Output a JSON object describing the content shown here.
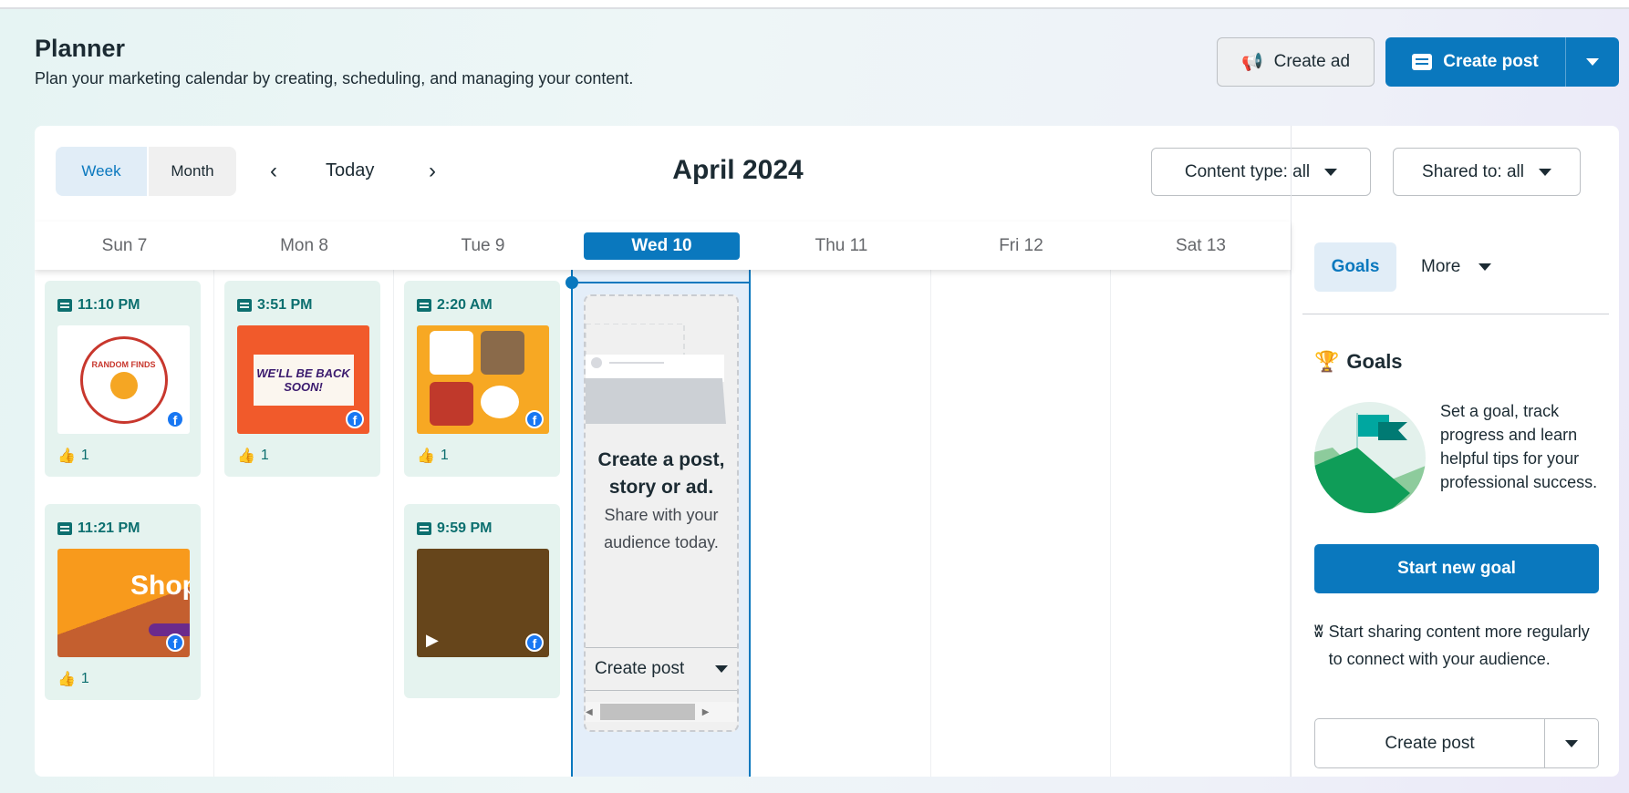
{
  "header": {
    "title": "Planner",
    "subtitle": "Plan your marketing calendar by creating, scheduling, and managing your content.",
    "create_ad_label": "Create ad",
    "create_post_label": "Create post"
  },
  "toolbar": {
    "views": [
      "Week",
      "Month"
    ],
    "active_view": "Week",
    "today_label": "Today",
    "period": "April 2024",
    "content_type_filter": "Content type: all",
    "shared_to_filter": "Shared to: all"
  },
  "days": [
    "Sun 7",
    "Mon 8",
    "Tue 9",
    "Wed 10",
    "Thu 11",
    "Fri 12",
    "Sat 13"
  ],
  "selected_day": "Wed 10",
  "posts": [
    {
      "day": "Sun 7",
      "time": "11:10 PM",
      "likes": "1",
      "image_text": "RANDOM FINDS",
      "platform": "facebook"
    },
    {
      "day": "Sun 7",
      "time": "11:21 PM",
      "likes": "1",
      "image_text": "Shop",
      "platform": "facebook"
    },
    {
      "day": "Mon 8",
      "time": "3:51 PM",
      "likes": "1",
      "image_text": "WE'LL BE BACK SOON!",
      "platform": "facebook"
    },
    {
      "day": "Tue 9",
      "time": "2:20 AM",
      "likes": "1",
      "image_text": "",
      "platform": "facebook"
    },
    {
      "day": "Tue 9",
      "time": "9:59 PM",
      "likes": "",
      "image_text": "",
      "platform": "facebook",
      "video": true
    }
  ],
  "placeholder": {
    "heading": "Create a post, story or ad.",
    "subtext": "Share with your audience today.",
    "button": "Create post"
  },
  "side_panel": {
    "tabs": [
      "Goals",
      "More"
    ],
    "active_tab": "Goals",
    "goals_heading": "Goals",
    "goals_text": "Set a goal, track progress and learn helpful tips for your professional success.",
    "start_goal_button": "Start new goal",
    "tip_text": "Start sharing content more regularly to connect with your audience.",
    "create_post_button": "Create post"
  },
  "colors": {
    "accent": "#0a78be",
    "post_card": "#e5f3ef",
    "post_text": "#0c6f6f"
  }
}
